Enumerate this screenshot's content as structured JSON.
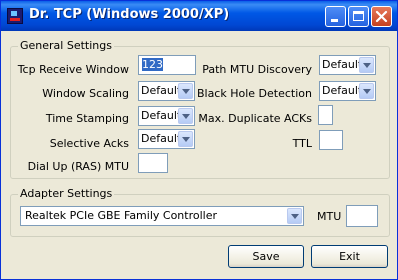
{
  "window": {
    "title": "Dr. TCP (Windows 2000/XP)"
  },
  "general": {
    "legend": "General Settings",
    "tcp_receive_window": {
      "label": "Tcp Receive Window",
      "value": "123"
    },
    "window_scaling": {
      "label": "Window Scaling",
      "value": "Default"
    },
    "time_stamping": {
      "label": "Time Stamping",
      "value": "Default"
    },
    "selective_acks": {
      "label": "Selective Acks",
      "value": "Default"
    },
    "dial_up_mtu": {
      "label": "Dial Up (RAS) MTU",
      "value": ""
    },
    "path_mtu_discovery": {
      "label": "Path MTU Discovery",
      "value": "Default"
    },
    "black_hole_detection": {
      "label": "Black Hole Detection",
      "value": "Default"
    },
    "max_duplicate_acks": {
      "label": "Max. Duplicate ACKs",
      "value": ""
    },
    "ttl": {
      "label": "TTL",
      "value": ""
    }
  },
  "adapter": {
    "legend": "Adapter Settings",
    "selected": "Realtek PCIe GBE Family Controller",
    "mtu_label": "MTU",
    "mtu_value": ""
  },
  "buttons": {
    "save": "Save",
    "exit": "Exit"
  },
  "colors": {
    "titlebar": "#0058e6",
    "close_button": "#c3401f",
    "dialog_bg": "#ece9d8",
    "field_border": "#7f9db9"
  }
}
